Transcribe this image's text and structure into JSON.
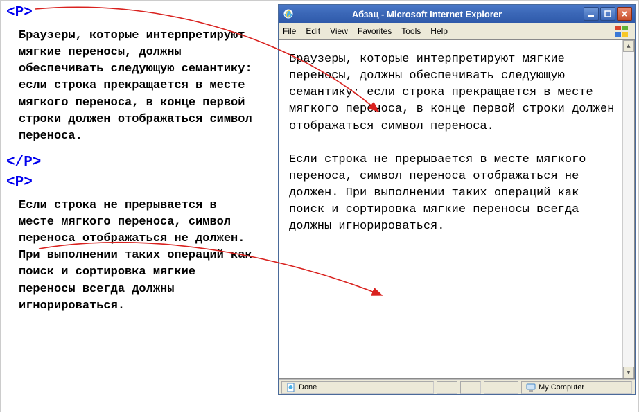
{
  "source": {
    "tag_open": "<P>",
    "tag_close": "</P>",
    "tag_open2": "<P>",
    "para1": "Браузеры, которые интерпретируют мягкие переносы, должны обеспечивать следующую семантику: если строка прекращается в месте мягкого переноса, в конце первой строки должен отображаться символ переноса.",
    "para2": "Если строка не прерывается в месте мягкого переноса, символ переноса отображаться не должен. При выполнении таких операций как поиск и сортировка мягкие переносы всегда должны игнорироваться."
  },
  "browser": {
    "title": "Абзац - Microsoft Internet Explorer",
    "menus": {
      "file": "File",
      "edit": "Edit",
      "view": "View",
      "favorites": "Favorites",
      "tools": "Tools",
      "help": "Help"
    },
    "content": {
      "para1": "Браузеры, которые интерпретируют мягкие переносы, должны обеспечивать следующую семантику: если строка прекращается в месте мягкого переноса, в конце первой строки должен отображаться символ переноса.",
      "para2": "Если строка не прерывается в месте мягкого переноса, символ переноса отображаться не должен. При выполнении таких операций как поиск и сортировка мягкие переносы всегда должны игнорироваться."
    },
    "status": {
      "done": "Done",
      "zone": "My Computer"
    }
  }
}
